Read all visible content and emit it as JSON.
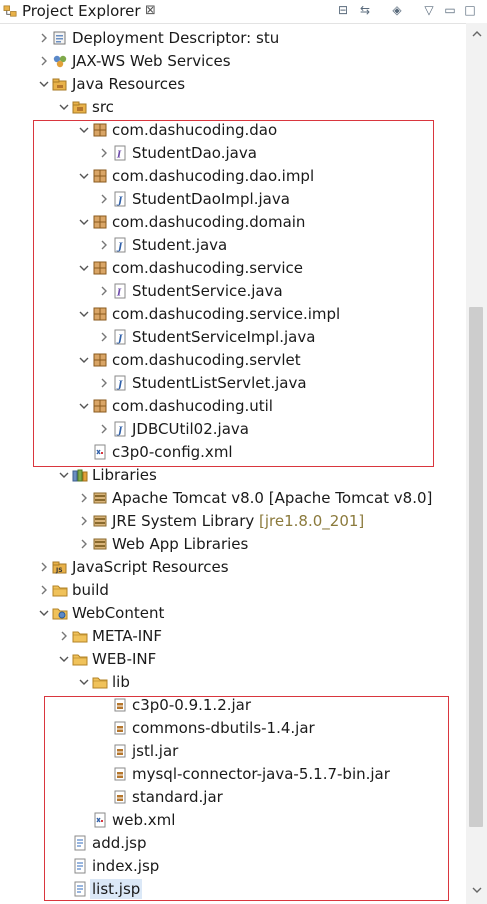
{
  "view": {
    "title": "Project Explorer",
    "close_glyph": "⊠",
    "toolbar": [
      {
        "name": "collapse-all-icon",
        "glyph": "⊟"
      },
      {
        "name": "link-with-editor-icon",
        "glyph": "⇆"
      },
      {
        "name": "focus-icon",
        "glyph": "◈"
      },
      {
        "name": "view-menu-icon",
        "glyph": "▽"
      },
      {
        "name": "minimize-icon",
        "glyph": "▭"
      },
      {
        "name": "maximize-icon",
        "glyph": "□"
      }
    ]
  },
  "tree": [
    {
      "label": "Deployment Descriptor: stu",
      "depth": 2,
      "toggle": "collapsed",
      "icon": "deployment-descriptor-icon"
    },
    {
      "label": "JAX-WS Web Services",
      "depth": 2,
      "toggle": "collapsed",
      "icon": "web-services-icon"
    },
    {
      "label": "Java Resources",
      "depth": 2,
      "toggle": "expanded",
      "icon": "java-resources-icon"
    },
    {
      "label": "src",
      "depth": 3,
      "toggle": "expanded",
      "icon": "source-folder-icon"
    },
    {
      "label": "com.dashucoding.dao",
      "depth": 4,
      "toggle": "expanded",
      "icon": "package-icon"
    },
    {
      "label": "StudentDao.java",
      "depth": 5,
      "toggle": "collapsed",
      "icon": "java-interface-file-icon"
    },
    {
      "label": "com.dashucoding.dao.impl",
      "depth": 4,
      "toggle": "expanded",
      "icon": "package-icon"
    },
    {
      "label": "StudentDaoImpl.java",
      "depth": 5,
      "toggle": "collapsed",
      "icon": "java-file-icon"
    },
    {
      "label": "com.dashucoding.domain",
      "depth": 4,
      "toggle": "expanded",
      "icon": "package-icon"
    },
    {
      "label": "Student.java",
      "depth": 5,
      "toggle": "collapsed",
      "icon": "java-file-icon"
    },
    {
      "label": "com.dashucoding.service",
      "depth": 4,
      "toggle": "expanded",
      "icon": "package-icon"
    },
    {
      "label": "StudentService.java",
      "depth": 5,
      "toggle": "collapsed",
      "icon": "java-interface-file-icon"
    },
    {
      "label": "com.dashucoding.service.impl",
      "depth": 4,
      "toggle": "expanded",
      "icon": "package-icon"
    },
    {
      "label": "StudentServiceImpl.java",
      "depth": 5,
      "toggle": "collapsed",
      "icon": "java-file-icon"
    },
    {
      "label": "com.dashucoding.servlet",
      "depth": 4,
      "toggle": "expanded",
      "icon": "package-icon"
    },
    {
      "label": "StudentListServlet.java",
      "depth": 5,
      "toggle": "collapsed",
      "icon": "java-file-icon"
    },
    {
      "label": "com.dashucoding.util",
      "depth": 4,
      "toggle": "expanded",
      "icon": "package-icon"
    },
    {
      "label": "JDBCUtil02.java",
      "depth": 5,
      "toggle": "collapsed",
      "icon": "java-file-icon"
    },
    {
      "label": "c3p0-config.xml",
      "depth": 4,
      "toggle": "none",
      "icon": "xml-file-icon"
    },
    {
      "label": "Libraries",
      "depth": 3,
      "toggle": "expanded",
      "icon": "libraries-icon"
    },
    {
      "label": "Apache Tomcat v8.0 [Apache Tomcat v8.0]",
      "depth": 4,
      "toggle": "collapsed",
      "icon": "library-icon"
    },
    {
      "label": "JRE System Library",
      "decoration": "[jre1.8.0_201]",
      "depth": 4,
      "toggle": "collapsed",
      "icon": "library-icon"
    },
    {
      "label": "Web App Libraries",
      "depth": 4,
      "toggle": "collapsed",
      "icon": "library-icon"
    },
    {
      "label": "JavaScript Resources",
      "depth": 2,
      "toggle": "collapsed",
      "icon": "javascript-resources-icon"
    },
    {
      "label": "build",
      "depth": 2,
      "toggle": "collapsed",
      "icon": "folder-icon"
    },
    {
      "label": "WebContent",
      "depth": 2,
      "toggle": "expanded",
      "icon": "web-content-folder-icon"
    },
    {
      "label": "META-INF",
      "depth": 3,
      "toggle": "collapsed",
      "icon": "folder-icon"
    },
    {
      "label": "WEB-INF",
      "depth": 3,
      "toggle": "expanded",
      "icon": "folder-icon"
    },
    {
      "label": "lib",
      "depth": 4,
      "toggle": "expanded",
      "icon": "folder-icon"
    },
    {
      "label": "c3p0-0.9.1.2.jar",
      "depth": 5,
      "toggle": "none",
      "icon": "jar-file-icon"
    },
    {
      "label": "commons-dbutils-1.4.jar",
      "depth": 5,
      "toggle": "none",
      "icon": "jar-file-icon"
    },
    {
      "label": "jstl.jar",
      "depth": 5,
      "toggle": "none",
      "icon": "jar-file-icon"
    },
    {
      "label": "mysql-connector-java-5.1.7-bin.jar",
      "depth": 5,
      "toggle": "none",
      "icon": "jar-file-icon"
    },
    {
      "label": "standard.jar",
      "depth": 5,
      "toggle": "none",
      "icon": "jar-file-icon"
    },
    {
      "label": "web.xml",
      "depth": 4,
      "toggle": "none",
      "icon": "xml-file-icon"
    },
    {
      "label": "add.jsp",
      "depth": 3,
      "toggle": "none",
      "icon": "jsp-file-icon"
    },
    {
      "label": "index.jsp",
      "depth": 3,
      "toggle": "none",
      "icon": "jsp-file-icon"
    },
    {
      "label": "list.jsp",
      "depth": 3,
      "toggle": "none",
      "icon": "jsp-file-icon",
      "selected": true
    }
  ],
  "colors": {
    "highlight_box": "#d9363e",
    "selection": "#dbe8f7",
    "decoration_text": "#8b7a3c",
    "package_brown": "#b5762c",
    "folder_yellow": "#e9b24a",
    "java_blue": "#2f5fa8"
  }
}
